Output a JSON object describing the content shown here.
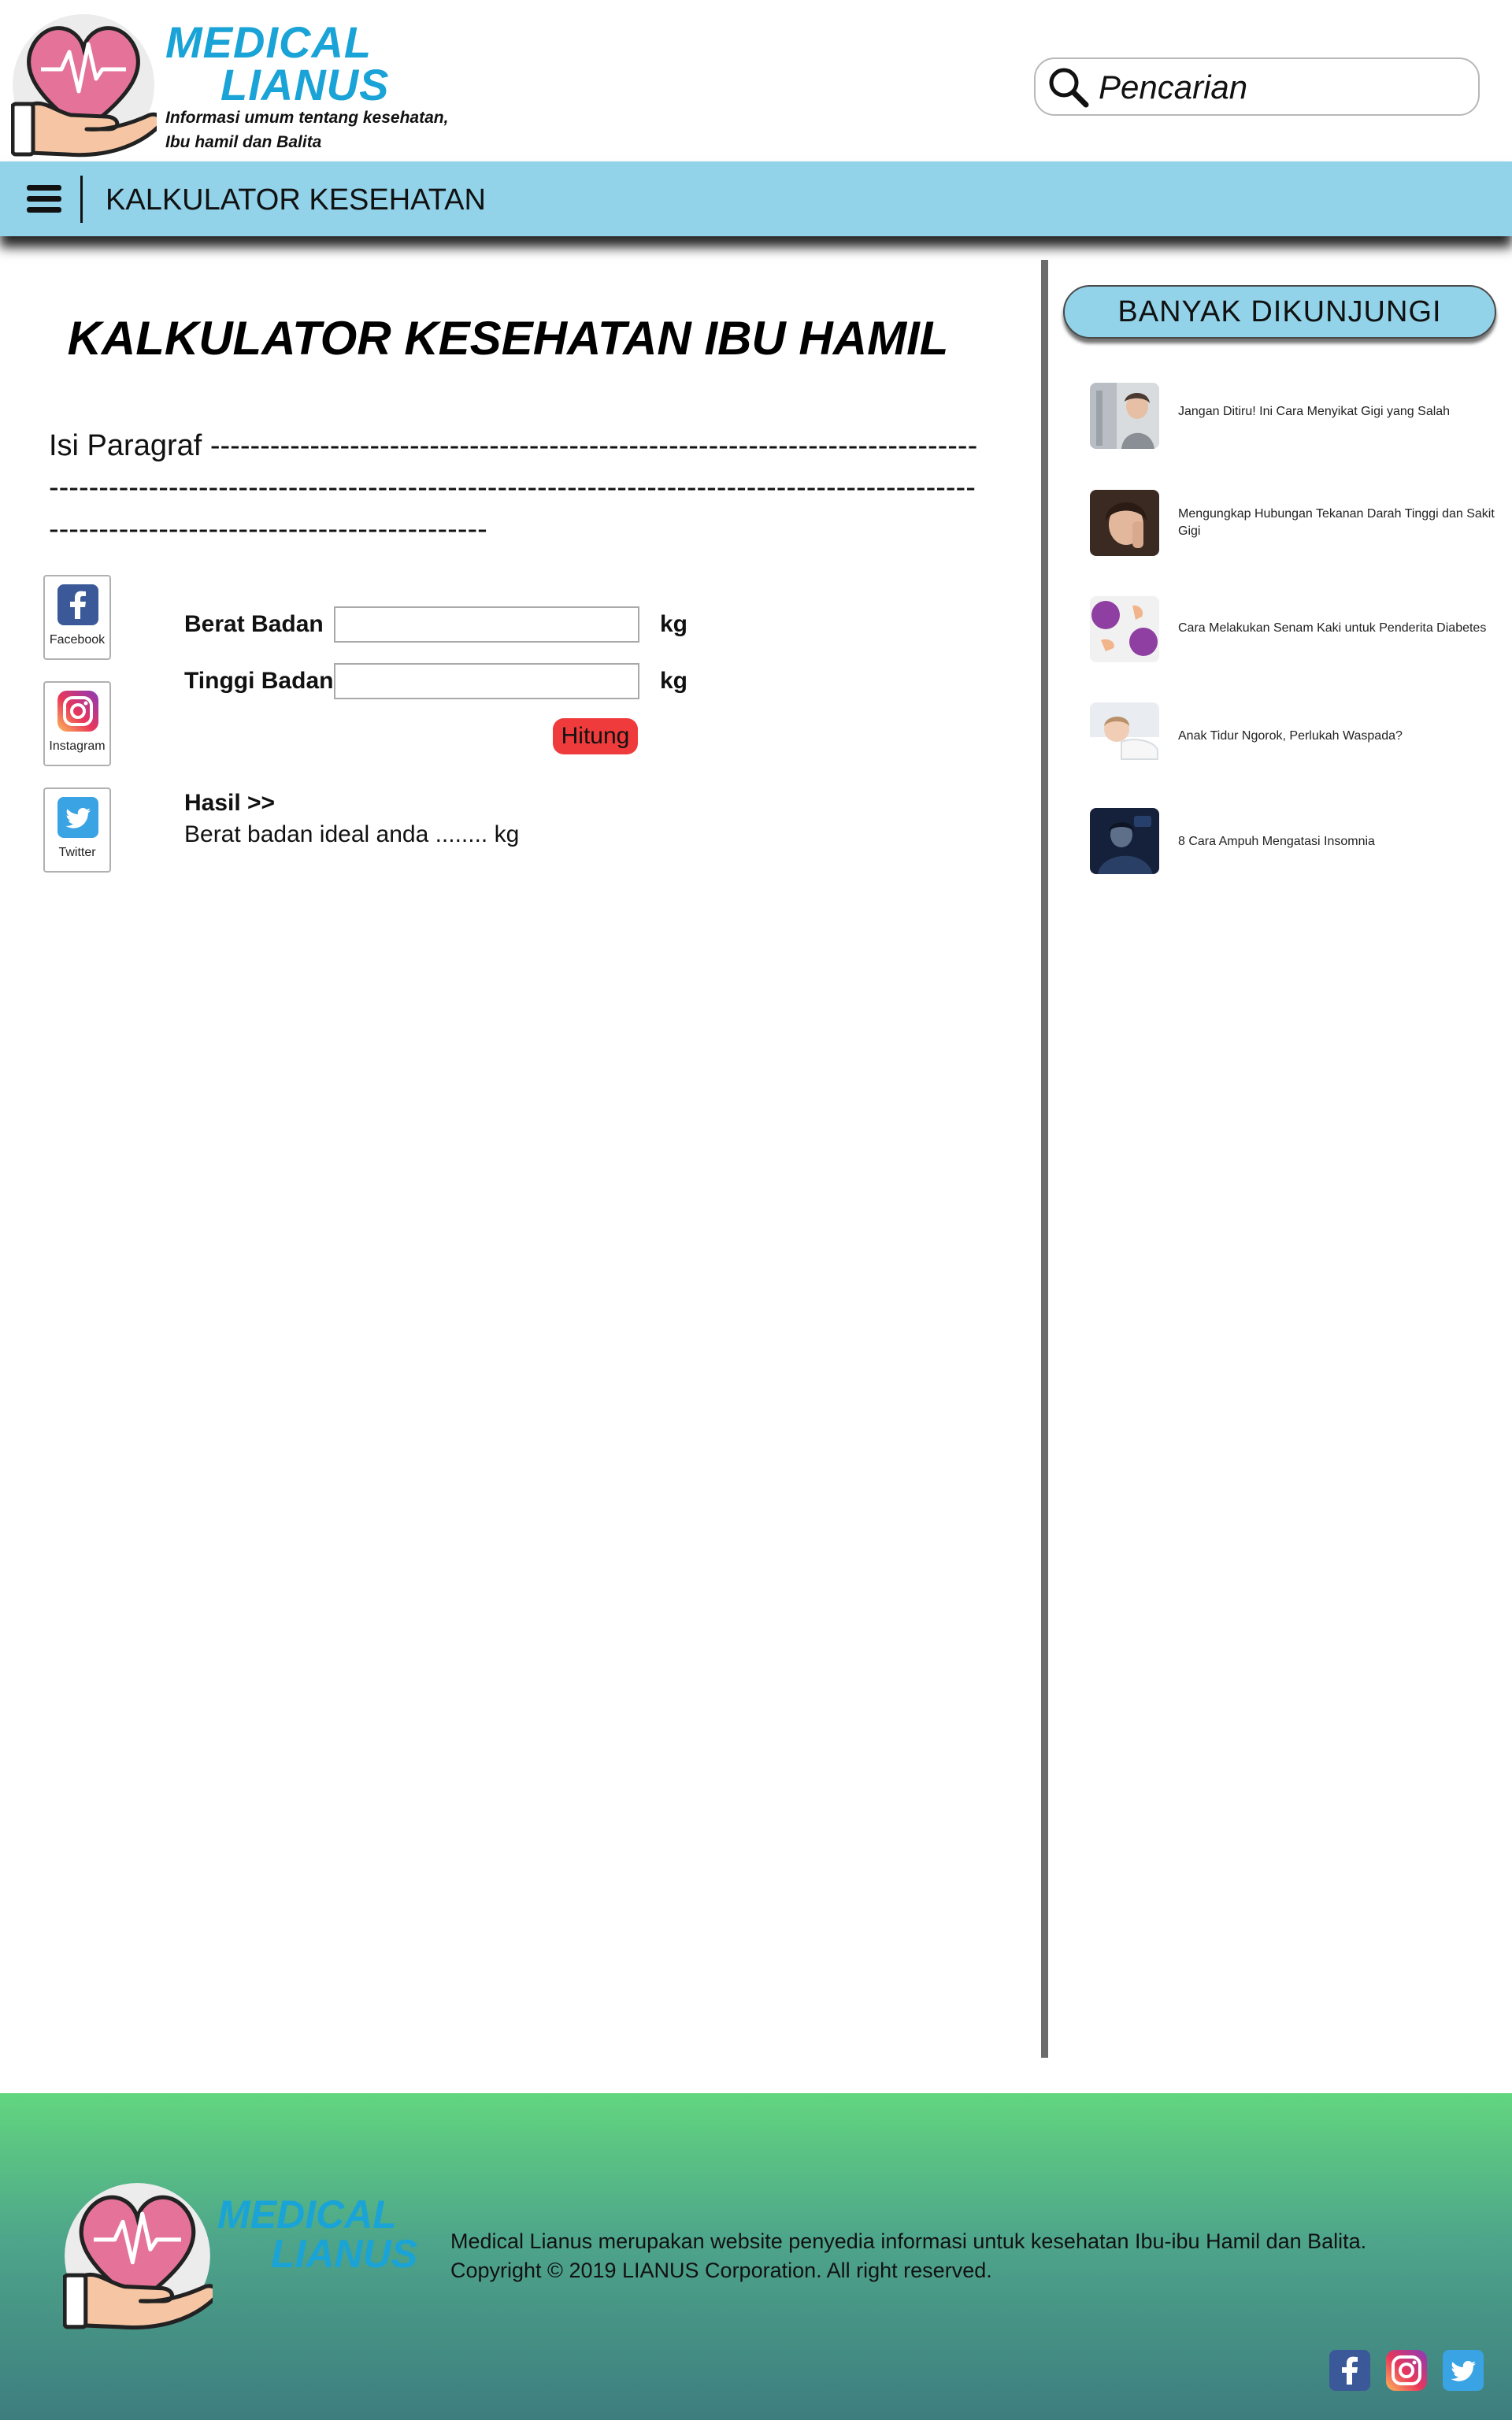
{
  "header": {
    "brand_line1": "MEDICAL",
    "brand_line2": "LIANUS",
    "tagline_line1": "Informasi umum tentang kesehatan,",
    "tagline_line2": "Ibu hamil dan Balita",
    "search_placeholder": "Pencarian"
  },
  "nav": {
    "title": "KALKULATOR KESEHATAN"
  },
  "main": {
    "title": "KALKULATOR KESEHATAN IBU HAMIL",
    "paragraph": "Isi Paragraf ----------------------------------------------------------------------------------------------------------------------------------------------------------------------------------------------------------------------",
    "social": [
      {
        "label": "Facebook"
      },
      {
        "label": "Instagram"
      },
      {
        "label": "Twitter"
      }
    ],
    "form": {
      "weight_label": "Berat Badan",
      "height_label": "Tinggi Badan",
      "unit_weight": "kg",
      "unit_height": "kg",
      "button": "Hitung"
    },
    "result": {
      "title": "Hasil >>",
      "text": "Berat badan ideal anda ........ kg"
    }
  },
  "sidebar": {
    "title": "BANYAK DIKUNJUNGI",
    "items": [
      {
        "title": "Jangan Ditiru! Ini Cara Menyikat Gigi yang Salah"
      },
      {
        "title": "Mengungkap Hubungan Tekanan Darah Tinggi dan Sakit Gigi"
      },
      {
        "title": "Cara Melakukan Senam Kaki untuk Penderita Diabetes"
      },
      {
        "title": "Anak Tidur Ngorok, Perlukah Waspada?"
      },
      {
        "title": "8 Cara Ampuh Mengatasi Insomnia"
      }
    ]
  },
  "footer": {
    "brand_line1": "MEDICAL",
    "brand_line2": "LIANUS",
    "description": "Medical Lianus merupakan website penyedia informasi untuk kesehatan Ibu-ibu Hamil dan Balita.",
    "copyright": "Copyright © 2019 LIANUS Corporation. All right reserved."
  },
  "colors": {
    "brand": "#1aa3d6",
    "nav": "#92d3ea",
    "button": "#ef3b3b",
    "footer_top": "#62d67f",
    "footer_bottom": "#3d7d7f"
  },
  "icons": [
    "heart-hand-logo-icon",
    "search-icon",
    "menu-icon",
    "facebook-icon",
    "instagram-icon",
    "twitter-icon"
  ]
}
